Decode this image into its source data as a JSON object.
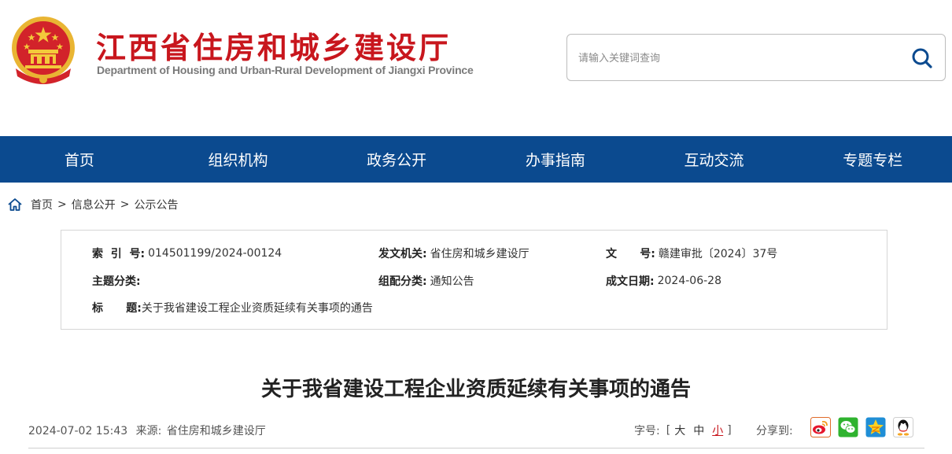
{
  "header": {
    "title": "江西省住房和城乡建设厅",
    "subtitle": "Department of Housing and Urban-Rural Development of Jiangxi Province",
    "emblem_icon": "national-emblem-icon",
    "accent_color": "#c8161d"
  },
  "search": {
    "placeholder": "请输入关键词查询",
    "value": "",
    "icon": "search-icon"
  },
  "nav": {
    "background": "#0b4a8f",
    "items": [
      "首页",
      "组织机构",
      "政务公开",
      "办事指南",
      "互动交流",
      "专题专栏"
    ]
  },
  "breadcrumb": {
    "icon": "home-icon",
    "items": [
      "首页",
      "信息公开",
      "公示公告"
    ],
    "separator": ">"
  },
  "info": {
    "index_no_label": "索  引  号:",
    "index_no": "014501199/2024-00124",
    "issuer_label": "发文机关:",
    "issuer": "省住房和城乡建设厅",
    "doc_no_label": "文      号:",
    "doc_no": "赣建审批〔2024〕37号",
    "topic_label": "主题分类:",
    "topic": "",
    "category_label": "组配分类:",
    "category": "通知公告",
    "date_label": "成文日期:",
    "date": "2024-06-28",
    "title_label": "标      题:",
    "title": "关于我省建设工程企业资质延续有关事项的通告"
  },
  "article": {
    "title": "关于我省建设工程企业资质延续有关事项的通告",
    "publish_time": "2024-07-02 15:43",
    "source_label": "来源:",
    "source": "省住房和城乡建设厅"
  },
  "font_size": {
    "label": "字号:",
    "open_bracket": "[",
    "large": "大",
    "medium": "中",
    "small": "小",
    "close_bracket": "]",
    "active": "small"
  },
  "share": {
    "label": "分享到:",
    "icons": [
      "weibo-icon",
      "wechat-icon",
      "qzone-icon",
      "qq-icon"
    ]
  }
}
